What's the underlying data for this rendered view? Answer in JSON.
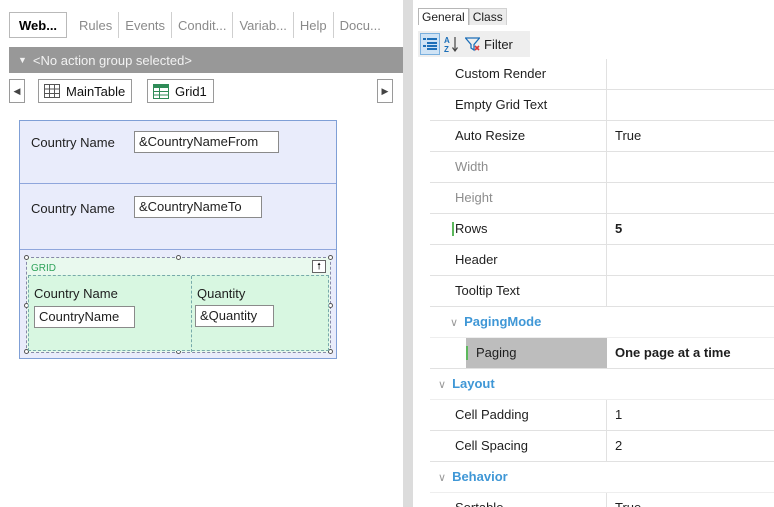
{
  "left_pane": {
    "tabs": [
      {
        "label": "Web...",
        "active": true
      },
      {
        "label": "Rules",
        "active": false
      },
      {
        "label": "Events",
        "active": false
      },
      {
        "label": "Condit...",
        "active": false
      },
      {
        "label": "Variab...",
        "active": false
      },
      {
        "label": "Help",
        "active": false
      },
      {
        "label": "Docu...",
        "active": false
      }
    ],
    "action_group": "<No action group selected>",
    "breadcrumbs": {
      "main": "MainTable",
      "grid": "Grid1"
    },
    "form": {
      "row1": {
        "label": "Country Name",
        "field": "&CountryNameFrom"
      },
      "row2": {
        "label": "Country Name",
        "field": "&CountryNameTo"
      },
      "grid": {
        "label": "GRID",
        "columns": [
          {
            "header": "Country Name",
            "field": "CountryName"
          },
          {
            "header": "Quantity",
            "field": "&Quantity"
          }
        ]
      }
    }
  },
  "right_pane": {
    "tabs": [
      {
        "label": "General",
        "active": true
      },
      {
        "label": "Class",
        "active": false
      }
    ],
    "toolbar": {
      "filter_label": "Filter"
    },
    "properties": [
      {
        "kind": "prop",
        "name": "Custom Render",
        "value": ""
      },
      {
        "kind": "prop",
        "name": "Empty Grid Text",
        "value": ""
      },
      {
        "kind": "prop",
        "name": "Auto Resize",
        "value": "True"
      },
      {
        "kind": "prop",
        "name": "Width",
        "value": "",
        "dim": true
      },
      {
        "kind": "prop",
        "name": "Height",
        "value": "",
        "dim": true
      },
      {
        "kind": "prop",
        "name": "Rows",
        "value": "5",
        "bold": true,
        "marker": true
      },
      {
        "kind": "prop",
        "name": "Header",
        "value": ""
      },
      {
        "kind": "prop",
        "name": "Tooltip Text",
        "value": ""
      },
      {
        "kind": "category",
        "name": "PagingMode",
        "sub": true
      },
      {
        "kind": "prop",
        "name": "Paging",
        "value": "One page at a time",
        "bold": true,
        "marker": true,
        "selected": true
      },
      {
        "kind": "category",
        "name": "Layout"
      },
      {
        "kind": "prop",
        "name": "Cell Padding",
        "value": "1"
      },
      {
        "kind": "prop",
        "name": "Cell Spacing",
        "value": "2"
      },
      {
        "kind": "category",
        "name": "Behavior"
      },
      {
        "kind": "prop",
        "name": "Sortable",
        "value": "True"
      }
    ]
  },
  "colors": {
    "category_blue": "#3f97d6",
    "form_bg": "#e9ecfb",
    "grid_bg": "#d8f7e1",
    "action_bar": "#989898",
    "modified_marker": "#5cb85c"
  }
}
